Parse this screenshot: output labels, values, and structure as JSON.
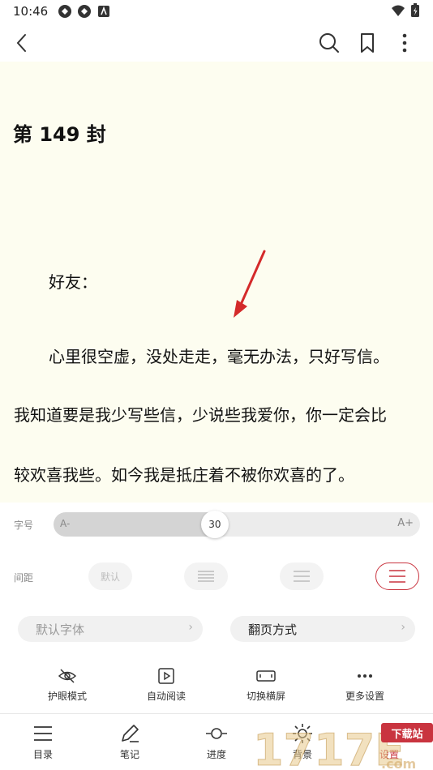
{
  "status_bar": {
    "time": "10:46"
  },
  "app_bar": {
    "back_icon": "chevron-left-icon",
    "actions": [
      "search-icon",
      "bookmark-icon",
      "more-vertical-icon"
    ]
  },
  "reader": {
    "background": "#fdfdf0",
    "chapter_title": "第 149 封",
    "paragraphs": [
      "好友：",
      "心里很空虚，没处走走，毫无办法，只好写信。",
      "我知道要是我少写些信，少说些我爱你，你一定会比",
      "较欢喜我些。如今我是抵庄着不被你欢喜的了。"
    ]
  },
  "font_size": {
    "label": "字号",
    "min_label": "A-",
    "max_label": "A+",
    "value": "30",
    "fraction": 0.44
  },
  "spacing": {
    "label": "间距",
    "options": [
      "默认",
      "compact",
      "normal",
      "loose"
    ],
    "active_index": 3
  },
  "pills": {
    "font": "默认字体",
    "page_turn": "翻页方式"
  },
  "tools": [
    {
      "label": "护眼模式",
      "icon": "eye-off-icon"
    },
    {
      "label": "自动阅读",
      "icon": "play-icon"
    },
    {
      "label": "切换横屏",
      "icon": "rotate-landscape-icon"
    },
    {
      "label": "更多设置",
      "icon": "more-horizontal-icon"
    }
  ],
  "bottom_nav": [
    {
      "label": "目录",
      "icon": "list-icon"
    },
    {
      "label": "笔记",
      "icon": "pen-icon"
    },
    {
      "label": "进度",
      "icon": "progress-icon"
    },
    {
      "label": "背景",
      "icon": "brightness-icon"
    },
    {
      "label": "设置",
      "icon": "settings-icon"
    }
  ],
  "watermark": {
    "text": "1717E",
    "badge": "下载站",
    "domain": ".com"
  },
  "colors": {
    "accent": "#c9343f",
    "reader_bg": "#fdfdf0"
  }
}
